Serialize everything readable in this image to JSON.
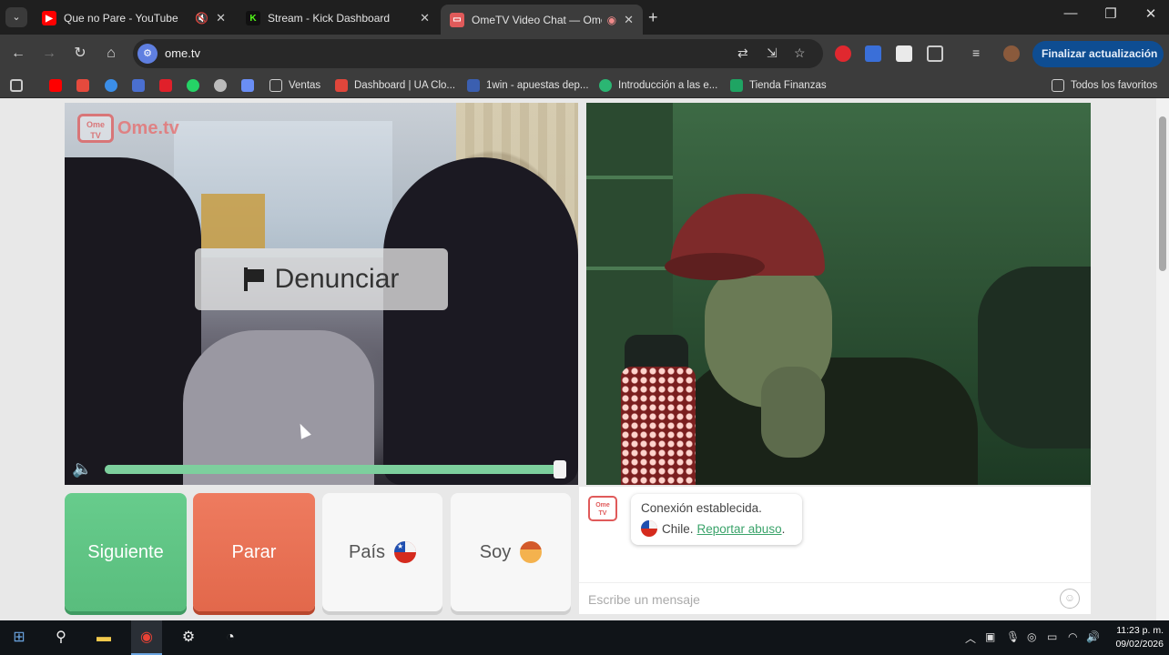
{
  "tabs": [
    {
      "title": "Que no Pare - YouTube",
      "favicon": "youtube-icon",
      "color": "#ff0000",
      "extra": "🔇"
    },
    {
      "title": "Stream - Kick Dashboard",
      "favicon": "kick-icon",
      "color": "#53fc18",
      "extra": ""
    },
    {
      "title": "OmeTV Video Chat — Ome",
      "favicon": "ometv-icon",
      "color": "#e05a5a",
      "extra": "◉"
    }
  ],
  "toolbar": {
    "url": "ome.tv",
    "update_button": "Finalizar actualización"
  },
  "bookmarks": {
    "items": [
      {
        "label": "Ventas",
        "icon": "folder-icon",
        "color": "#cfcfcf"
      },
      {
        "label": "Dashboard | UA Clo...",
        "icon": "ua-icon",
        "color": "#e0463b"
      },
      {
        "label": "1win - apuestas dep...",
        "icon": "1win-icon",
        "color": "#3b5fb0"
      },
      {
        "label": "Introducción a las e...",
        "icon": "intro-icon",
        "color": "#2bb673"
      },
      {
        "label": "Tienda Finanzas",
        "icon": "sheets-icon",
        "color": "#1fa463"
      }
    ],
    "all_label": "Todos los favoritos"
  },
  "video": {
    "logo_text": "Ome.tv",
    "report_label": "Denunciar",
    "volume_level": 0.98
  },
  "buttons": {
    "next": "Siguiente",
    "stop": "Parar",
    "country": "País",
    "gender": "Soy"
  },
  "chat": {
    "status": "Conexión establecida.",
    "country": "Chile.",
    "report_link": "Reportar abuso",
    "input_placeholder": "Escribe un mensaje"
  },
  "taskbar": {
    "time": "11:23 p. m.",
    "date": "09/02/2026"
  },
  "colors": {
    "next": "#5fc583",
    "stop": "#e8705a",
    "link": "#3aa36a",
    "update": "#0e4d92"
  }
}
